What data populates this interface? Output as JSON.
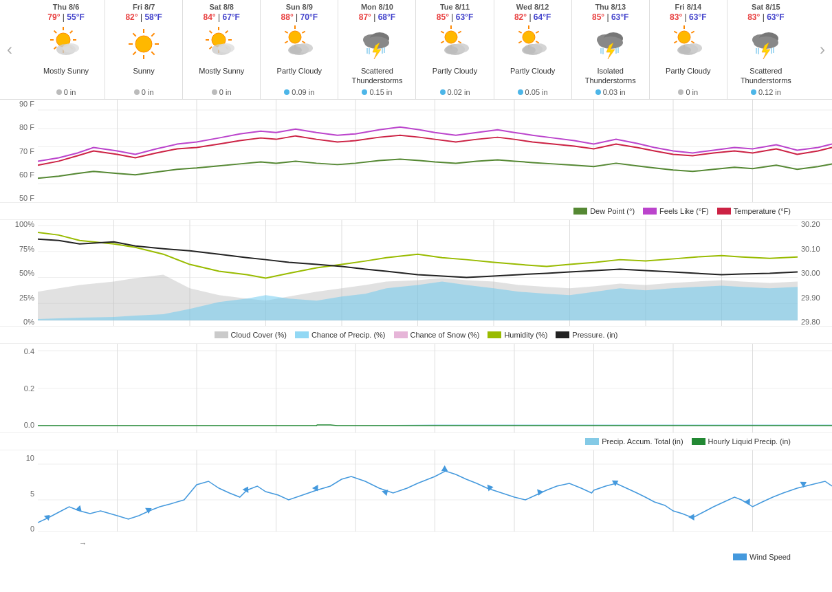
{
  "nav": {
    "prev": "‹",
    "next": "›"
  },
  "days": [
    {
      "id": "thu-8-6",
      "name": "Thu 8/6",
      "high": "79°",
      "low": "55°F",
      "condition": "Mostly Sunny",
      "precip": "0 in",
      "precipType": "gray",
      "icon": "mostly-sunny"
    },
    {
      "id": "fri-8-7",
      "name": "Fri 8/7",
      "high": "82°",
      "low": "58°F",
      "condition": "Sunny",
      "precip": "0 in",
      "precipType": "gray",
      "icon": "sunny"
    },
    {
      "id": "sat-8-8",
      "name": "Sat 8/8",
      "high": "84°",
      "low": "67°F",
      "condition": "Mostly Sunny",
      "precip": "0 in",
      "precipType": "gray",
      "icon": "mostly-sunny"
    },
    {
      "id": "sun-8-9",
      "name": "Sun 8/9",
      "high": "88°",
      "low": "70°F",
      "condition": "Partly Cloudy",
      "precip": "0.09 in",
      "precipType": "blue",
      "icon": "partly-cloudy"
    },
    {
      "id": "mon-8-10",
      "name": "Mon 8/10",
      "high": "87°",
      "low": "68°F",
      "condition": "Scattered Thunderstorms",
      "precip": "0.15 in",
      "precipType": "blue",
      "icon": "thunderstorm"
    },
    {
      "id": "tue-8-11",
      "name": "Tue 8/11",
      "high": "85°",
      "low": "63°F",
      "condition": "Partly Cloudy",
      "precip": "0.02 in",
      "precipType": "blue",
      "icon": "partly-cloudy"
    },
    {
      "id": "wed-8-12",
      "name": "Wed 8/12",
      "high": "82°",
      "low": "64°F",
      "condition": "Partly Cloudy",
      "precip": "0.05 in",
      "precipType": "blue",
      "icon": "partly-cloudy"
    },
    {
      "id": "thu-8-13",
      "name": "Thu 8/13",
      "high": "85°",
      "low": "63°F",
      "condition": "Isolated Thunderstorms",
      "precip": "0.03 in",
      "precipType": "blue",
      "icon": "thunderstorm"
    },
    {
      "id": "fri-8-14",
      "name": "Fri 8/14",
      "high": "83°",
      "low": "63°F",
      "condition": "Partly Cloudy",
      "precip": "0 in",
      "precipType": "gray",
      "icon": "partly-cloudy"
    },
    {
      "id": "sat-8-15",
      "name": "Sat 8/15",
      "high": "83°",
      "low": "63°F",
      "condition": "Scattered Thunderstorms",
      "precip": "0.12 in",
      "precipType": "blue",
      "icon": "thunderstorm"
    }
  ],
  "legend_temp": {
    "dew_point": "Dew Point (°)",
    "feels_like": "Feels Like (°F)",
    "temperature": "Temperature (°F)"
  },
  "legend_humid": {
    "cloud_cover": "Cloud Cover (%)",
    "precip_chance": "Chance of Precip. (%)",
    "snow_chance": "Chance of Snow (%)",
    "humidity": "Humidity (%)",
    "pressure": "Pressure. (in)"
  },
  "legend_precip": {
    "accum": "Precip. Accum. Total (in)",
    "hourly": "Hourly Liquid Precip. (in)"
  },
  "legend_wind": {
    "wind_speed": "Wind Speed"
  },
  "y_axis_temp": [
    "90 F",
    "80 F",
    "70 F",
    "60 F",
    "50 F"
  ],
  "y_axis_humid": [
    "100%",
    "75%",
    "50%",
    "25%",
    "0%"
  ],
  "y_axis_humid_right": [
    "30.20",
    "30.10",
    "30.00",
    "29.90",
    "29.80"
  ],
  "y_axis_precip": [
    "0.4",
    "0.2",
    "0.0"
  ],
  "y_axis_wind": [
    "10",
    "5",
    "0"
  ],
  "arrow_label": "→"
}
